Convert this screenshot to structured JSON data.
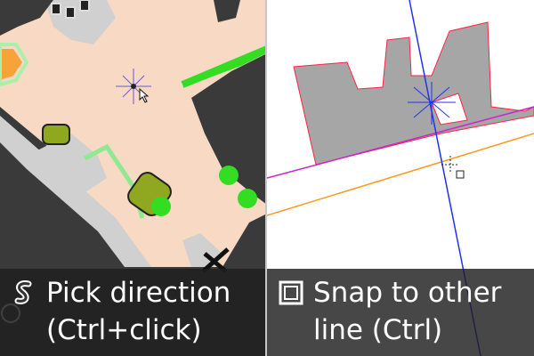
{
  "tips": [
    {
      "icon": "s-curve-icon",
      "line1": "Pick direction",
      "line2": "(Ctrl+click)"
    },
    {
      "icon": "checkbox-square-icon",
      "line1": "Snap to other",
      "line2": "line (Ctrl)"
    }
  ],
  "colors": {
    "caption_background": "#1e1e1e",
    "caption_text": "#ffffff",
    "map_ground": "#f8d9c4",
    "map_building": "#d0d0d0",
    "map_dark": "#3a3a3a",
    "map_green": "#33dd22",
    "map_olive": "#8fa820",
    "building_fill": "#a6a6a6",
    "building_outline": "#ff2244",
    "guide_blue": "#2233ee",
    "guide_magenta": "#cc22cc",
    "guide_orange": "#ff9922"
  }
}
